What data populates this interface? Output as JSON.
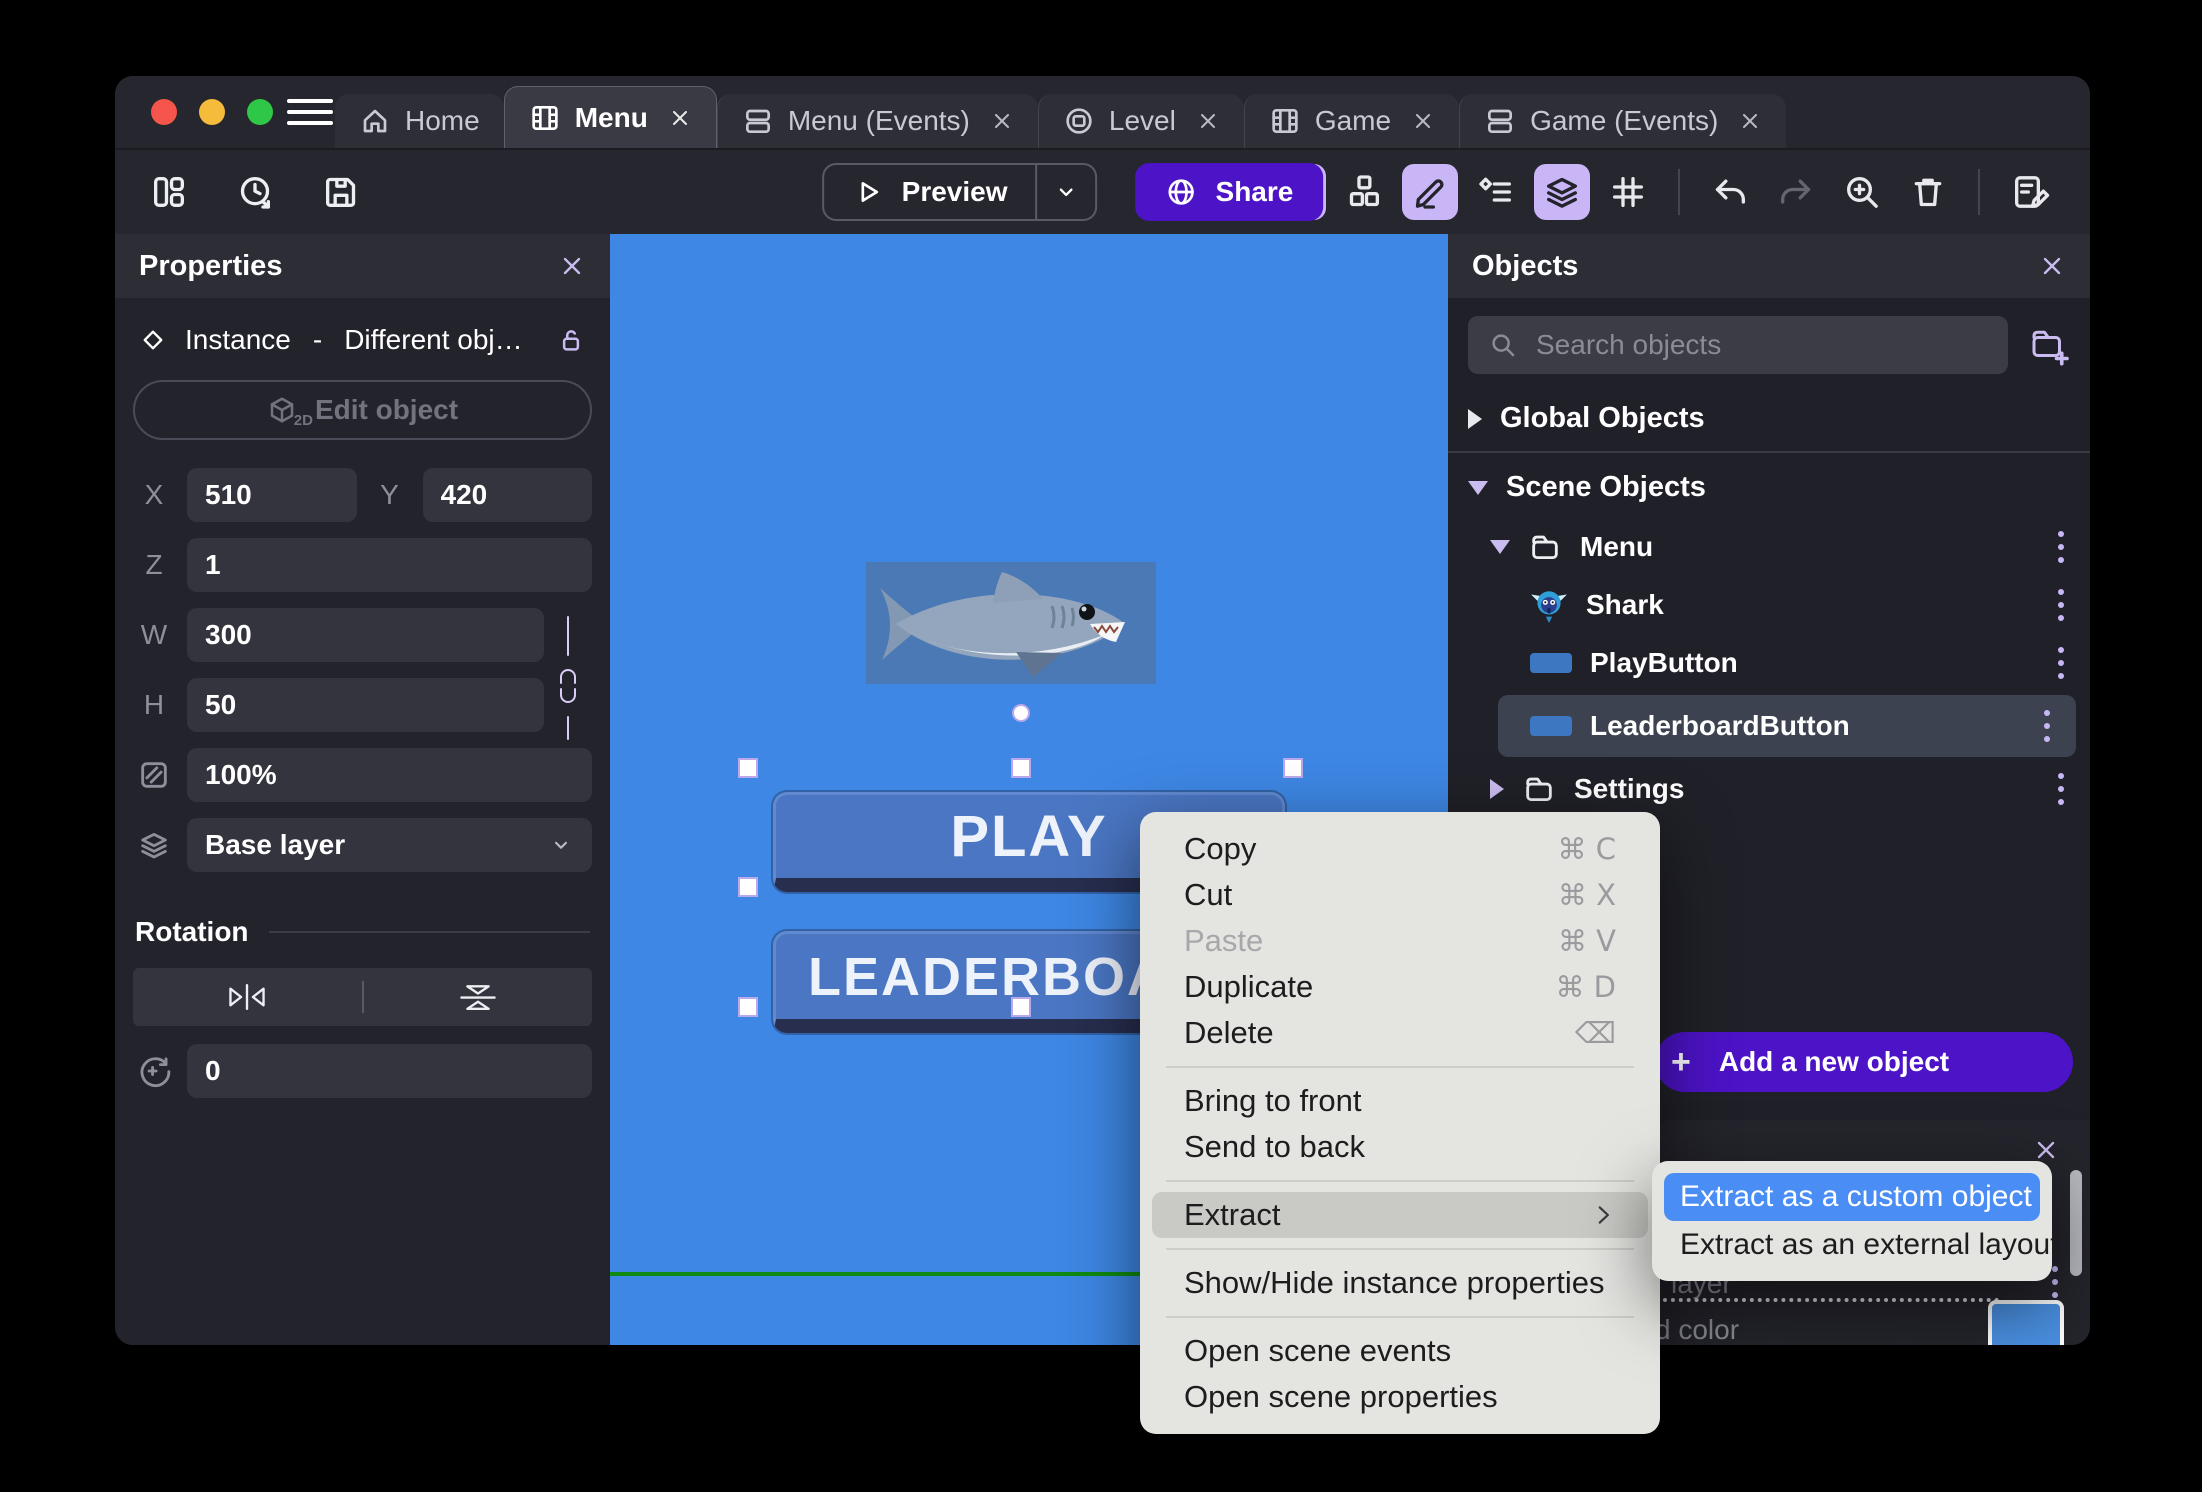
{
  "tabs": [
    {
      "label": "Home",
      "icon": "home",
      "active": false,
      "closable": false
    },
    {
      "label": "Menu",
      "icon": "scene",
      "active": true,
      "closable": true
    },
    {
      "label": "Menu (Events)",
      "icon": "events",
      "active": false,
      "closable": true
    },
    {
      "label": "Level",
      "icon": "external-layout",
      "active": false,
      "closable": true
    },
    {
      "label": "Game",
      "icon": "scene",
      "active": false,
      "closable": true
    },
    {
      "label": "Game (Events)",
      "icon": "events",
      "active": false,
      "closable": true
    }
  ],
  "toolbar": {
    "preview_label": "Preview",
    "share_label": "Share"
  },
  "properties": {
    "title": "Properties",
    "instance_type": "Instance",
    "instance_separator": "-",
    "instance_object": "Different obj…",
    "edit_object_label": "Edit object",
    "edit_object_badge": "2D",
    "x_label": "X",
    "x_value": "510",
    "y_label": "Y",
    "y_value": "420",
    "z_label": "Z",
    "z_value": "1",
    "w_label": "W",
    "w_value": "300",
    "h_label": "H",
    "h_value": "50",
    "opacity_value": "100%",
    "layer_value": "Base layer",
    "rotation_title": "Rotation",
    "rotation_value": "0"
  },
  "canvas": {
    "play_label": "PLAY",
    "leaderboard_label": "LEADERBOARD"
  },
  "objects": {
    "title": "Objects",
    "search_placeholder": "Search objects",
    "global_section": "Global Objects",
    "scene_section": "Scene Objects",
    "tree": [
      {
        "label": "Menu",
        "type": "folder",
        "expanded": true
      },
      {
        "label": "Shark",
        "type": "sprite"
      },
      {
        "label": "PlayButton",
        "type": "button-object"
      },
      {
        "label": "LeaderboardButton",
        "type": "button-object",
        "selected": true
      },
      {
        "label": "Settings",
        "type": "folder",
        "expanded": false
      }
    ],
    "add_plus": "+",
    "add_button": "Add a new object",
    "bottom": {
      "layer_text": "layer",
      "color_text": "d color"
    }
  },
  "context_menu": {
    "items": [
      {
        "label": "Copy",
        "shortcut": "⌘ C"
      },
      {
        "label": "Cut",
        "shortcut": "⌘ X"
      },
      {
        "label": "Paste",
        "shortcut": "⌘ V",
        "disabled": true
      },
      {
        "label": "Duplicate",
        "shortcut": "⌘ D"
      },
      {
        "label": "Delete",
        "shortcut": "⌫"
      },
      {
        "label": "Bring to front"
      },
      {
        "label": "Send to back"
      },
      {
        "label": "Extract",
        "has_submenu": true,
        "highlighted": true
      },
      {
        "label": "Show/Hide instance properties"
      },
      {
        "label": "Open scene events"
      },
      {
        "label": "Open scene properties"
      }
    ],
    "submenu": [
      {
        "label": "Extract as a custom object",
        "selected": true
      },
      {
        "label": "Extract as an external layout",
        "selected": false
      }
    ]
  },
  "colors": {
    "accent_purple": "#4c13c7",
    "canvas_blue": "#3e87e4",
    "selection_blue": "#4a8ef5",
    "lavender_accent": "#c9b6f7"
  }
}
